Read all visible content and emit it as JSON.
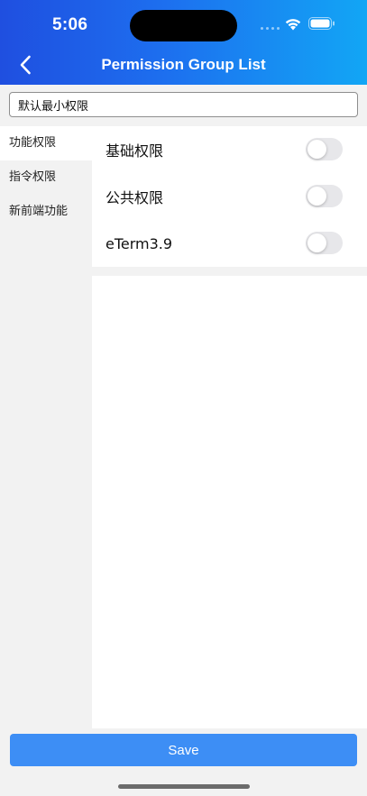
{
  "status_bar": {
    "time": "5:06"
  },
  "nav": {
    "title": "Permission Group List",
    "back_icon": "chevron-left-icon"
  },
  "search": {
    "value": "默认最小权限"
  },
  "sidebar": {
    "items": [
      {
        "label": "功能权限",
        "active": true
      },
      {
        "label": "指令权限",
        "active": false
      },
      {
        "label": "新前端功能",
        "active": false
      }
    ]
  },
  "permissions": {
    "items": [
      {
        "label": "基础权限",
        "enabled": false
      },
      {
        "label": "公共权限",
        "enabled": false
      },
      {
        "label": "eTerm3.9",
        "enabled": false
      }
    ]
  },
  "footer": {
    "save_label": "Save"
  },
  "colors": {
    "header_start": "#1f4fe0",
    "header_end": "#12a6f5",
    "save_button": "#3d8ef5"
  }
}
